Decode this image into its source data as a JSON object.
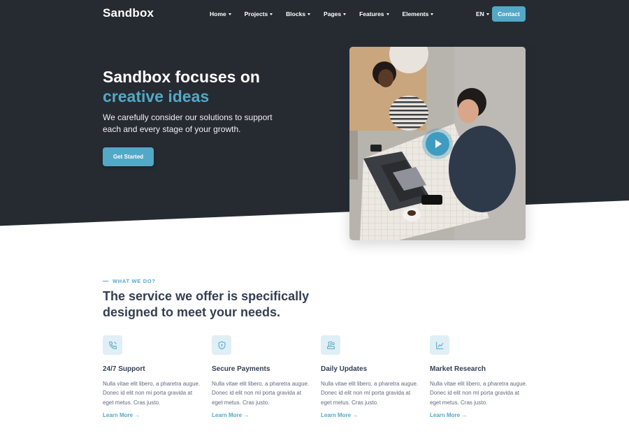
{
  "brand": {
    "logo_text": "Sandbox"
  },
  "nav": {
    "items": [
      {
        "label": "Home"
      },
      {
        "label": "Projects"
      },
      {
        "label": "Blocks"
      },
      {
        "label": "Pages"
      },
      {
        "label": "Features"
      },
      {
        "label": "Elements"
      }
    ],
    "language": "EN",
    "contact_label": "Contact"
  },
  "hero": {
    "title_line1": "Sandbox focuses on",
    "title_line2": "creative ideas",
    "subtitle": "We carefully consider our solutions to support each and every stage of your growth.",
    "cta_label": "Get Started",
    "media_icon": "play-icon"
  },
  "services": {
    "eyebrow": "WHAT WE DO?",
    "title": "The service we offer is specifically designed to meet your needs.",
    "items": [
      {
        "icon": "phone-icon",
        "title": "24/7 Support",
        "desc": "Nulla vitae elit libero, a pharetra augue. Donec id elit non mi porta gravida at eget metus. Cras justo.",
        "link": "Learn More →"
      },
      {
        "icon": "shield-icon",
        "title": "Secure Payments",
        "desc": "Nulla vitae elit libero, a pharetra augue. Donec id elit non mi porta gravida at eget metus. Cras justo.",
        "link": "Learn More →"
      },
      {
        "icon": "update-icon",
        "title": "Daily Updates",
        "desc": "Nulla vitae elit libero, a pharetra augue. Donec id elit non mi porta gravida at eget metus. Cras justo.",
        "link": "Learn More →"
      },
      {
        "icon": "chart-icon",
        "title": "Market Research",
        "desc": "Nulla vitae elit libero, a pharetra augue. Donec id elit non mi porta gravida at eget metus. Cras justo.",
        "link": "Learn More →"
      }
    ]
  },
  "colors": {
    "dark_bg": "#262b32",
    "accent": "#54a8c7",
    "heading": "#343f52",
    "body_text": "#60697b",
    "icon_bg": "#e0eff5"
  }
}
